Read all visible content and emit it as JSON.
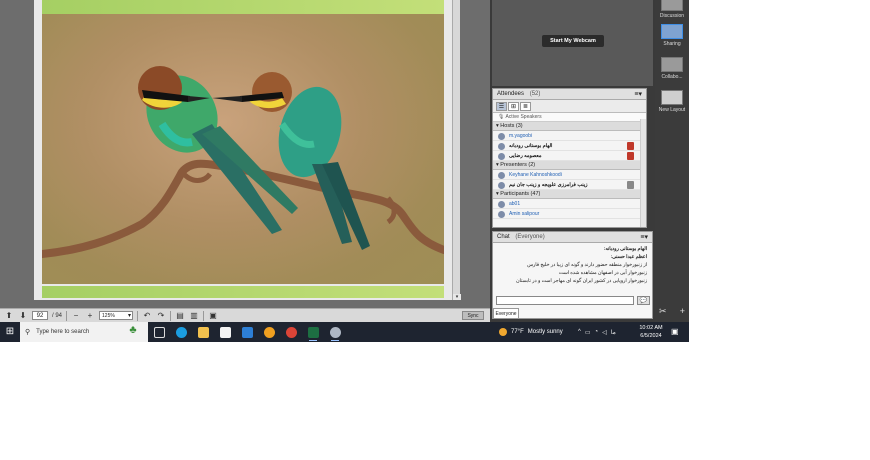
{
  "document": {
    "current_page": "92",
    "page_total": "/ 94",
    "zoom": "125%",
    "sync_label": "Sync"
  },
  "webcam": {
    "button_label": "Start My Webcam"
  },
  "attendees": {
    "title": "Attendees",
    "count": "(52)",
    "active_speakers": "Active Speakers",
    "groups": [
      {
        "label": "▾ Hosts (3)",
        "members": [
          {
            "name": "m.yagoobi",
            "style": "blue",
            "status": ""
          },
          {
            "name": "الهام بوستانی رودبانه",
            "style": "bold",
            "status": "red"
          },
          {
            "name": "معصومه رضایی",
            "style": "bold",
            "status": "red"
          }
        ]
      },
      {
        "label": "▾ Presenters (2)",
        "members": [
          {
            "name": "Keyhane Kahnoshkoodi",
            "style": "blue",
            "status": ""
          },
          {
            "name": "زینب فرامرزی علویجه و زینب جان نیم",
            "style": "bold",
            "status": "grey"
          }
        ]
      },
      {
        "label": "▾ Participants (47)",
        "members": [
          {
            "name": "ab01",
            "style": "blue",
            "status": ""
          },
          {
            "name": "Amin salipour",
            "style": "blue",
            "status": ""
          }
        ]
      }
    ]
  },
  "chat": {
    "title": "Chat",
    "scope": "(Everyone)",
    "messages": [
      {
        "name": "الهام بوستانی رودبانه:",
        "text": ""
      },
      {
        "name": "اعظم عبدا حسنی:",
        "text": ""
      },
      {
        "name": "",
        "text": "از زنبورخوار منطقه حضور دارند و گونه ای زیبا در خلیج فارس"
      },
      {
        "name": "",
        "text": "زنبورخوار آبی در اصفهان مشاهده شده است"
      },
      {
        "name": "",
        "text": "زنبورخوار اروپایی در کشور ایران گونه ای مهاجر است و در تابستان"
      }
    ],
    "tab": "Everyone"
  },
  "layouts": {
    "items": [
      {
        "label": "Discussion"
      },
      {
        "label": "Sharing"
      },
      {
        "label": "Collabo..."
      },
      {
        "label": "New Layout"
      }
    ]
  },
  "taskbar": {
    "search_placeholder": "Type here to search",
    "weather_temp": "77°F",
    "weather_text": "Mostly sunny",
    "time": "10:02 AM",
    "date": "6/5/2024",
    "lang": "ما"
  },
  "colors": {
    "accent": "#3f8fe6",
    "taskbar": "#1e2430",
    "photo_bg": "#b08f64"
  }
}
